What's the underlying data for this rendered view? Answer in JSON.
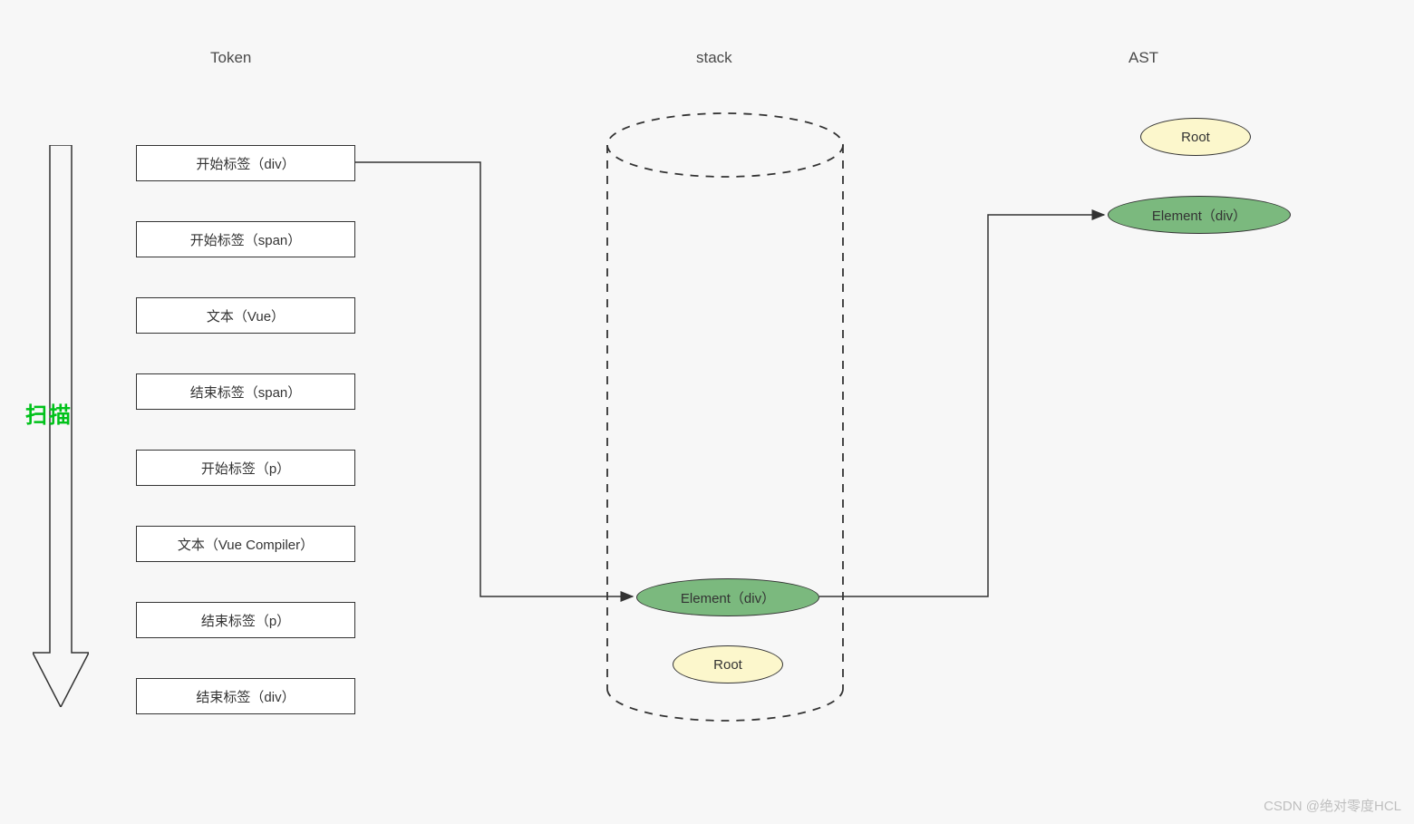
{
  "titles": {
    "token": "Token",
    "stack": "stack",
    "ast": "AST"
  },
  "scan_label": "扫描",
  "tokens": [
    "开始标签（div）",
    "开始标签（span）",
    "文本（Vue）",
    "结束标签（span）",
    "开始标签（p）",
    "文本（Vue Compiler）",
    "结束标签（p）",
    "结束标签（div）"
  ],
  "stack_nodes": {
    "element_div": "Element（div）",
    "root": "Root"
  },
  "ast_nodes": {
    "root": "Root",
    "element_div": "Element（div）"
  },
  "watermark": "CSDN @绝对零度HCL"
}
